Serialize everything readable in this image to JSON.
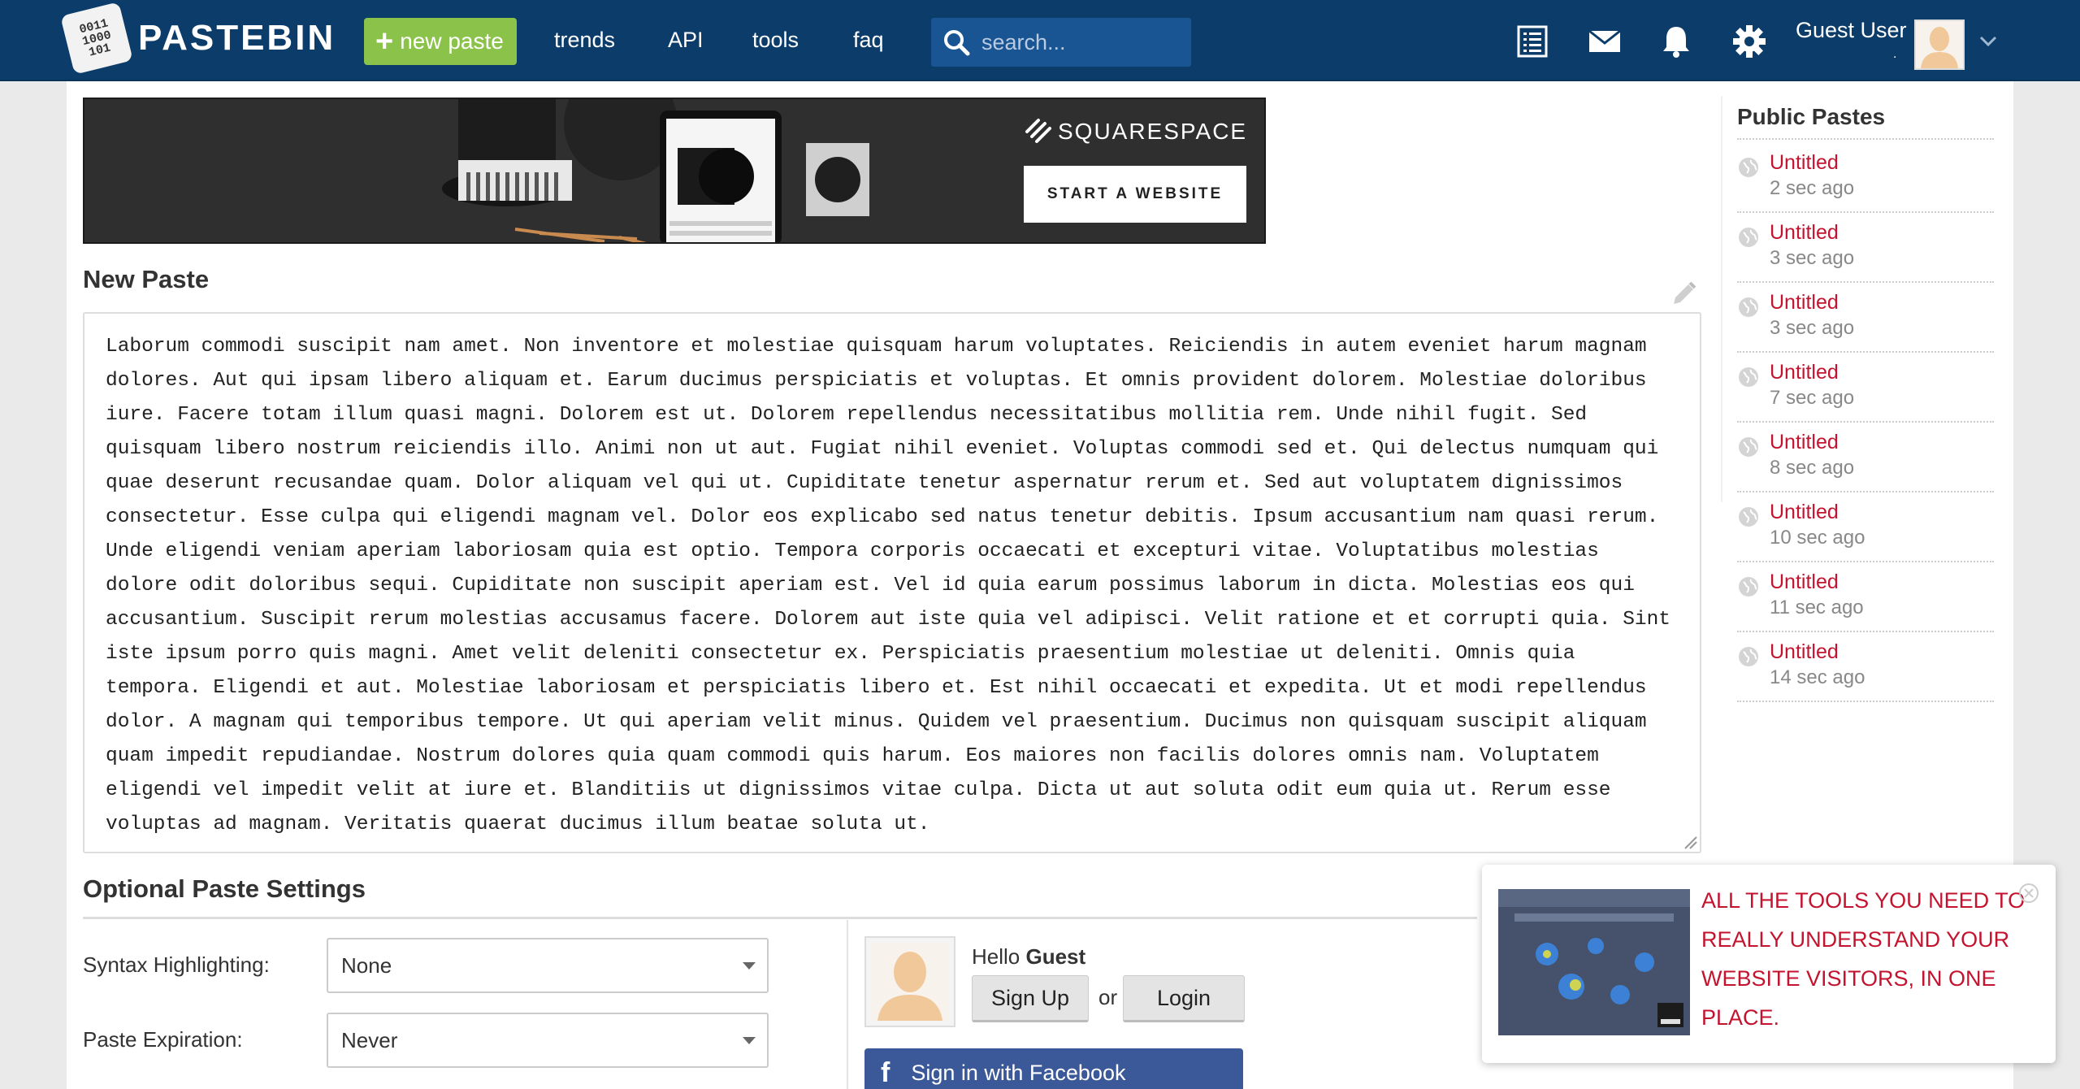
{
  "header": {
    "logo_text": "PASTEBIN",
    "logo_bits": "0011\n1000\n101",
    "new_paste_label": "new paste",
    "nav": [
      "trends",
      "API",
      "tools",
      "faq"
    ],
    "search_placeholder": "search...",
    "user_name": "Guest User",
    "user_sub": "."
  },
  "ad_banner": {
    "brand": "SQUARESPACE",
    "cta": "START A WEBSITE"
  },
  "main": {
    "new_paste_title": "New Paste",
    "paste_text": "Laborum commodi suscipit nam amet. Non inventore et molestiae quisquam harum voluptates. Reiciendis in autem eveniet harum magnam dolores. Aut qui ipsam libero aliquam et. Earum ducimus perspiciatis et voluptas. Et omnis provident dolorem. Molestiae doloribus iure. Facere totam illum quasi magni. Dolorem est ut. Dolorem repellendus necessitatibus mollitia rem. Unde nihil fugit. Sed quisquam libero nostrum reiciendis illo. Animi non ut aut. Fugiat nihil eveniet. Voluptas commodi sed et. Qui delectus numquam qui quae deserunt recusandae quam. Dolor aliquam vel qui ut. Cupiditate tenetur aspernatur rerum et. Sed aut voluptatem dignissimos consectetur. Esse culpa qui eligendi magnam vel. Dolor eos explicabo sed natus tenetur debitis. Ipsum accusantium nam quasi rerum. Unde eligendi veniam aperiam laboriosam quia est optio. Tempora corporis occaecati et excepturi vitae. Voluptatibus molestias dolore odit doloribus sequi. Cupiditate non suscipit aperiam est. Vel id quia earum possimus laborum in dicta. Molestias eos qui accusantium. Suscipit rerum molestias accusamus facere. Dolorem aut iste quia vel adipisci. Velit ratione et et corrupti quia. Sint iste ipsum porro quis magni. Amet velit deleniti consectetur ex. Perspiciatis praesentium molestiae ut deleniti. Omnis quia tempora. Eligendi et aut. Molestiae laboriosam et perspiciatis libero et. Est nihil occaecati et expedita. Ut et modi repellendus dolor. A magnam qui temporibus tempore. Ut qui aperiam velit minus. Quidem vel praesentium. Ducimus non quisquam suscipit aliquam quam impedit repudiandae. Nostrum dolores quia quam commodi quis harum. Eos maiores non facilis dolores omnis nam. Voluptatem eligendi vel impedit velit at iure et. Blanditiis ut dignissimos vitae culpa. Dicta ut aut soluta odit eum quia ut. Rerum esse voluptas ad magnam. Veritatis quaerat ducimus illum beatae soluta ut.",
    "optional_title": "Optional Paste Settings",
    "syntax_label": "Syntax Highlighting:",
    "syntax_value": "None",
    "expiration_label": "Paste Expiration:",
    "expiration_value": "Never"
  },
  "guest_box": {
    "hello": "Hello",
    "guest": "Guest",
    "signup": "Sign Up",
    "or": "or",
    "login": "Login",
    "facebook": "Sign in with Facebook"
  },
  "sidebar": {
    "title": "Public Pastes",
    "items": [
      {
        "title": "Untitled",
        "time": "2 sec ago"
      },
      {
        "title": "Untitled",
        "time": "3 sec ago"
      },
      {
        "title": "Untitled",
        "time": "3 sec ago"
      },
      {
        "title": "Untitled",
        "time": "7 sec ago"
      },
      {
        "title": "Untitled",
        "time": "8 sec ago"
      },
      {
        "title": "Untitled",
        "time": "10 sec ago"
      },
      {
        "title": "Untitled",
        "time": "11 sec ago"
      },
      {
        "title": "Untitled",
        "time": "14 sec ago"
      }
    ]
  },
  "popup_ad": {
    "text": "ALL THE TOOLS YOU NEED TO REALLY UNDERSTAND YOUR WEBSITE VISITORS, IN ONE PLACE."
  },
  "colors": {
    "header_bg": "#0c3d6a",
    "new_paste_green": "#8bc34a",
    "link_red": "#c4132f",
    "facebook_blue": "#3b5998"
  }
}
